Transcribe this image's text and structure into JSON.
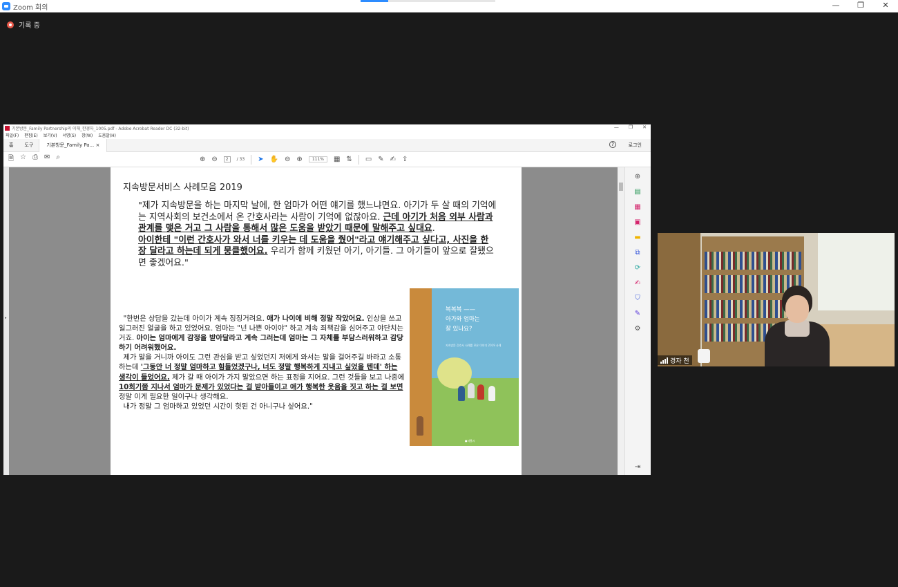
{
  "zoom": {
    "title": "Zoom 회의",
    "recording_label": "기록 중",
    "controls": {
      "minimize": "—",
      "restore": "❐",
      "close": "✕"
    },
    "participant_name": "경자 천"
  },
  "acrobat": {
    "window_title": "기본방문_Family Partnership의 이해_한경자_1005.pdf - Adobe Acrobat Reader DC (32-bit)",
    "menu": [
      "파일(F)",
      "편집(E)",
      "보기(V)",
      "서명(S)",
      "창(W)",
      "도움말(H)"
    ],
    "tabs": {
      "home": "홈",
      "tools": "도구",
      "doc": "기본방문_Family Pa...",
      "doc_close": "×"
    },
    "login": "로그인",
    "page_current": "2",
    "page_total": "/ 33",
    "zoom_value": "111%"
  },
  "page": {
    "header": "지속방문서비스 사례모음 2019",
    "quote1": {
      "p1": "\"제가 지속방문을 하는 마지막 날에, 한 엄마가 어떤 얘기를 했느냐면요. 아기가 두 살 때의 기억에는 지역사회의 보건소에서 온 간호사라는 사람이 기억에 없잖아요. ",
      "u1": "근데 아기가 처음 외부 사람과 관계를 맺은 거고 그 사람을 통해서 많은 도움을 받았기 때문에 말해주고 싶대요",
      "p2": ".",
      "u2": "아이한테 \"이런 간호사가 와서 너를 키우는 데 도움을 줬어\"라고 얘기해주고 싶다고, 사진을 한 장 달라고 하는데 되게 뭉클했어요.",
      "p3": " 우리가 함께 키웠던 아기, 아기들. 그 아기들이 앞으로 잘됐으면 좋겠어요.\""
    },
    "quote2": {
      "a": "\"한번은 상담을 갔는데 아이가 계속 징징거려요. ",
      "b": "애가 나이에 비해 정말 작았어요.",
      "c": " 인상을 쓰고 일그러진 얼굴을 하고 있었어요. 엄마는 \"넌 나쁜 아이야\" 하고 계속 죄책감을 심어주고 야단치는 거죠. ",
      "d": "아이는 엄마에게 감정을 받아달라고 계속 그러는데 엄마는 그 자체를 부담스러워하고 감당하기 어려워했어요.",
      "e": "제가 말을 거니까 아이도 그런 관심을 받고 싶었던지 저에게 와서는 말을 걸어주길 바라고 소통하는데 ",
      "f": "'그동안 너 정말 엄마하고 힘들었겠구나, 너도 정말 행복하게 지내고 싶었을 텐데' 하는 생각이 들었어요.",
      "g": " 제가 갈 때 아이가 가지 말았으면 하는 표정을 지어요. 그런 것들을 보고 나중에 ",
      "h": "10회기쯤 지나서 엄마가 문제가 있었다는 걸 받아들이고 애가 행복한 웃음을 짓고 하는 걸 보면",
      "i": " 정말 이게 필요한 일이구나 생각해요.",
      "j": "내가 정말 그 엄마하고 있었던 시간이 헛된 건 아니구나 싶어요.\""
    },
    "book": {
      "title_line1": "복복복 ——",
      "title_line2": "아가와 엄마는",
      "title_line3": "잘 있나요?",
      "subtitle": "지속방문 간호사 사례를 모은 이야기 2019 사례",
      "publisher": "●서울시"
    }
  },
  "colors": {
    "zoom_blue": "#2d8cff",
    "record_red": "#e8594a",
    "acrobat_red": "#c8102e",
    "rail_pink": "#d4246c"
  }
}
